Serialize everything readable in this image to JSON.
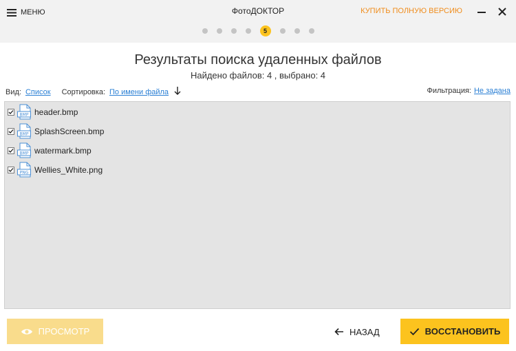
{
  "titlebar": {
    "menu_label": "МЕНЮ",
    "app_title": "ФотоДОКТОР",
    "buy_label": "КУПИТЬ ПОЛНУЮ ВЕРСИЮ"
  },
  "steps": {
    "current": "5",
    "total": 8
  },
  "header": {
    "title": "Результаты поиска удаленных файлов",
    "subtitle": "Найдено файлов: 4 , выбрано: 4"
  },
  "options": {
    "view_label": "Вид:",
    "view_value": "Список",
    "sort_label": "Сортировка:",
    "sort_value": "По имени файла",
    "filter_label": "Фильтрация:",
    "filter_value": "Не задана"
  },
  "files": [
    {
      "name": "header.bmp",
      "type": "BMP",
      "checked": true
    },
    {
      "name": "SplashScreen.bmp",
      "type": "BMP",
      "checked": true
    },
    {
      "name": "watermark.bmp",
      "type": "BMP",
      "checked": true
    },
    {
      "name": "Wellies_White.png",
      "type": "PNG",
      "checked": true
    }
  ],
  "footer": {
    "preview_label": "ПРОСМОТР",
    "back_label": "НАЗАД",
    "restore_label": "ВОССТАНОВИТЬ"
  },
  "colors": {
    "accent": "#fcc31e",
    "accent_disabled": "#f9dc8c",
    "link": "#2a7fd4",
    "buy": "#f08c1a",
    "file_icon": "#4a8fd6",
    "panel_bg": "#e4e4e4"
  },
  "icons": {
    "menu": "hamburger-icon",
    "minimize": "minimize-icon",
    "close": "close-icon",
    "sort": "arrow-down-icon",
    "file": "image-file-icon",
    "preview": "eye-icon",
    "back": "arrow-left-icon",
    "restore": "checkmark-icon"
  }
}
